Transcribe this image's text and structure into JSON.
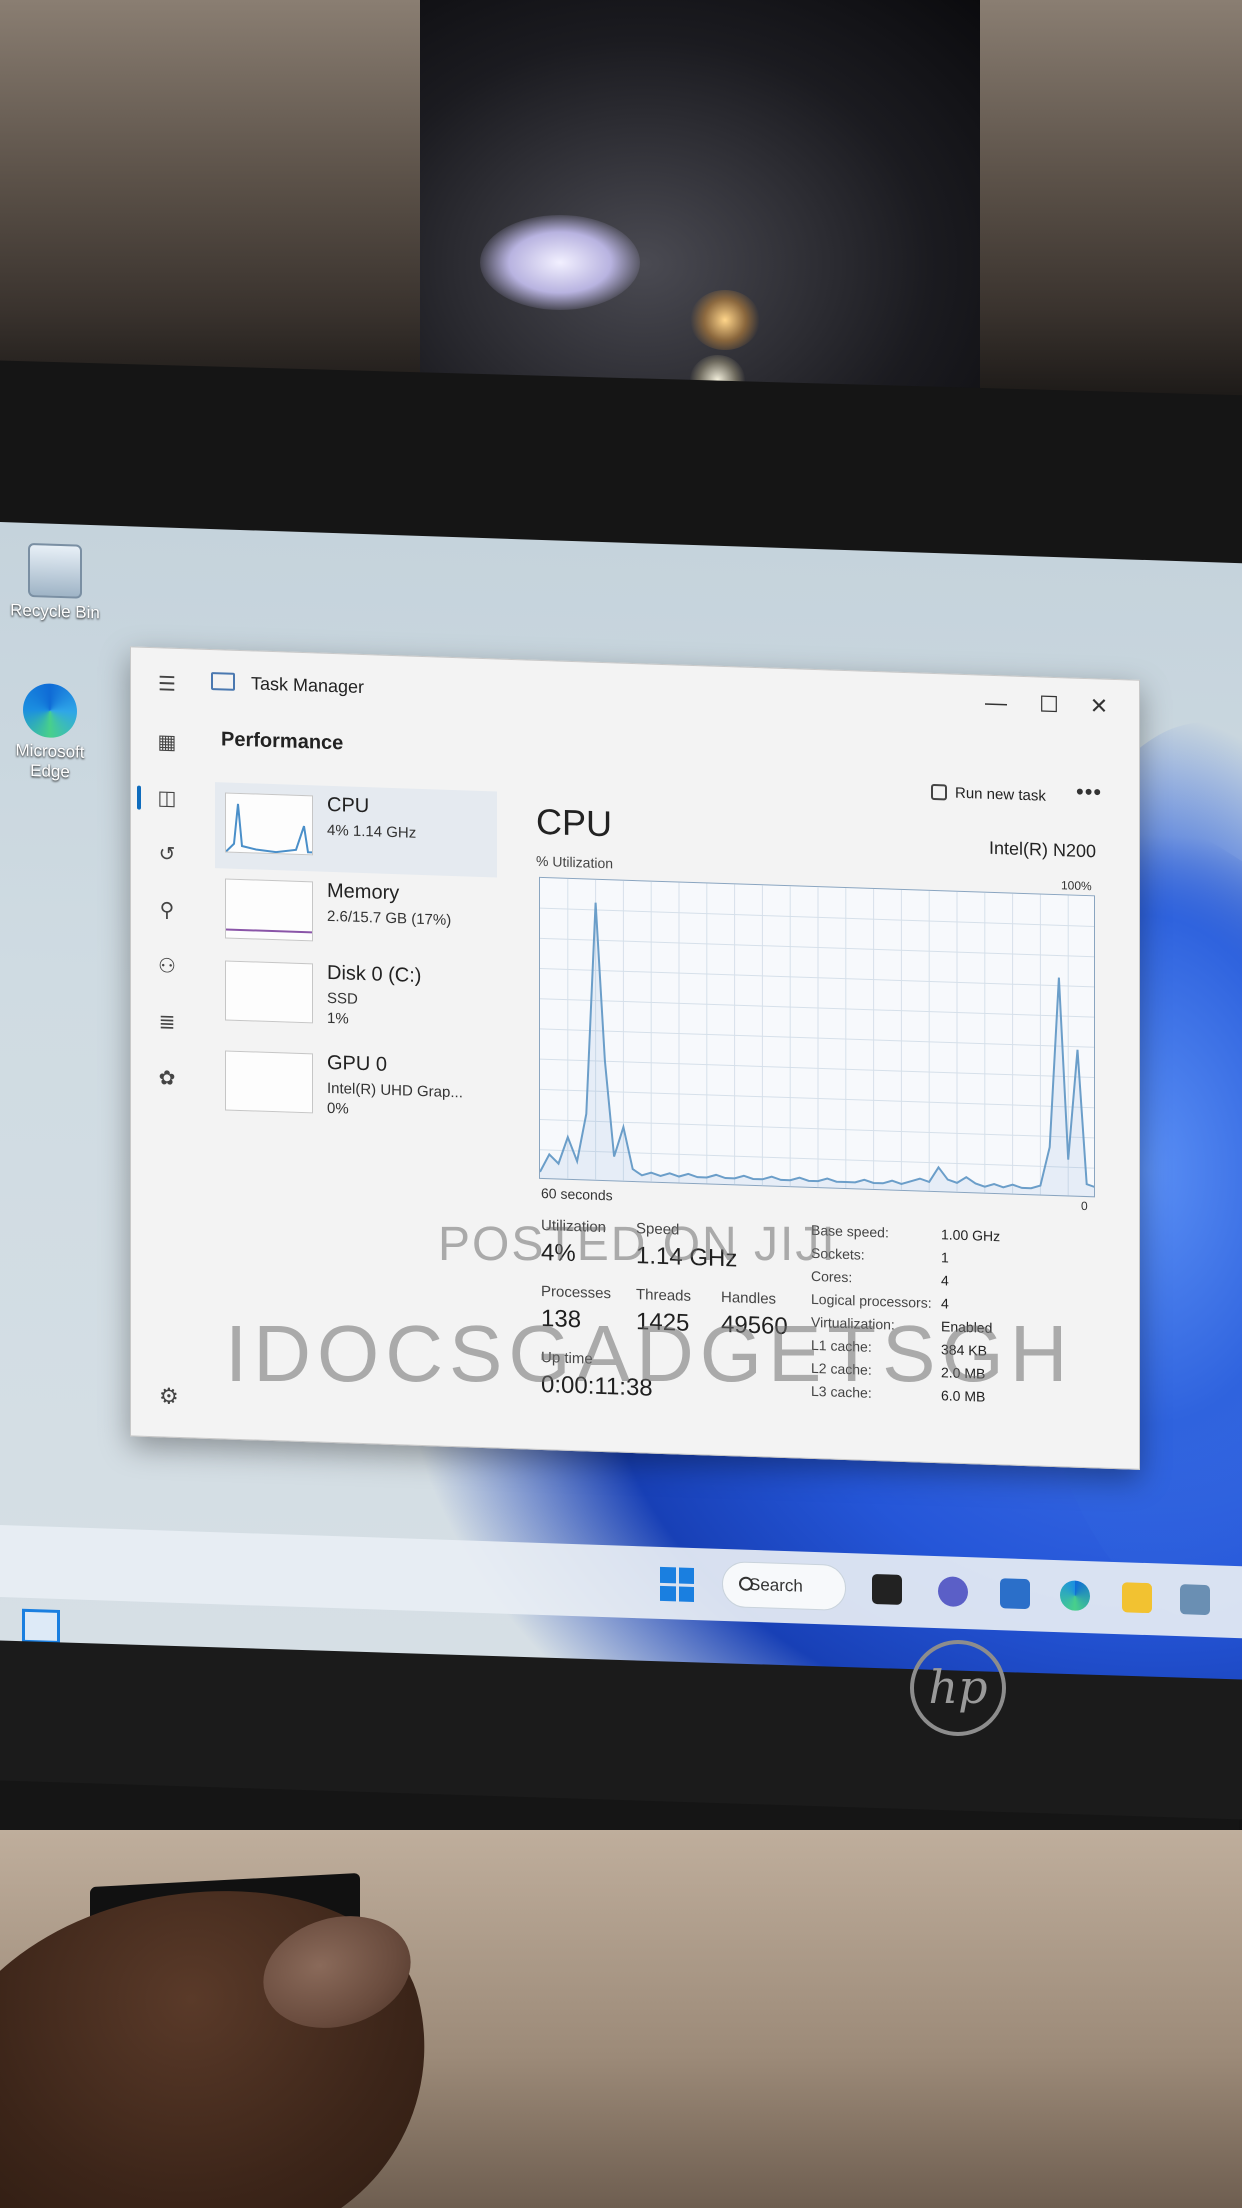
{
  "desktop": {
    "icons": [
      {
        "label": "Recycle Bin"
      },
      {
        "label": "Microsoft Edge"
      }
    ]
  },
  "taskbar": {
    "search_label": "Search"
  },
  "task_manager": {
    "title": "Task Manager",
    "section": "Performance",
    "run_new_task": "Run new task",
    "more": "•••",
    "window_buttons": {
      "minimize": "—",
      "maximize": "☐",
      "close": "✕"
    },
    "devices": [
      {
        "name": "CPU",
        "sub1": "4%  1.14 GHz",
        "sub2": ""
      },
      {
        "name": "Memory",
        "sub1": "2.6/15.7 GB (17%)",
        "sub2": ""
      },
      {
        "name": "Disk 0 (C:)",
        "sub1": "SSD",
        "sub2": "1%"
      },
      {
        "name": "GPU 0",
        "sub1": "Intel(R) UHD Grap...",
        "sub2": "0%"
      }
    ],
    "detail": {
      "title": "CPU",
      "model": "Intel(R) N200",
      "util_label": "% Utilization",
      "max_label": "100%",
      "time_label": "60 seconds",
      "min_label": "0",
      "stats": {
        "utilization_label": "Utilization",
        "utilization": "4%",
        "speed_label": "Speed",
        "speed": "1.14 GHz",
        "processes_label": "Processes",
        "processes": "138",
        "threads_label": "Threads",
        "threads": "1425",
        "handles_label": "Handles",
        "handles": "49560",
        "uptime_label": "Up time",
        "uptime": "0:00:11:38"
      },
      "specs": [
        {
          "k": "Base speed:",
          "v": "1.00 GHz"
        },
        {
          "k": "Sockets:",
          "v": "1"
        },
        {
          "k": "Cores:",
          "v": "4"
        },
        {
          "k": "Logical processors:",
          "v": "4"
        },
        {
          "k": "Virtualization:",
          "v": "Enabled"
        },
        {
          "k": "L1 cache:",
          "v": "384 KB"
        },
        {
          "k": "L2 cache:",
          "v": "2.0 MB"
        },
        {
          "k": "L3 cache:",
          "v": "6.0 MB"
        }
      ]
    }
  },
  "watermark": {
    "line1": "POSTED ON JIJI",
    "line2": "IDOCSGADGETSGH"
  },
  "brand_logo": "hp",
  "chart_data": {
    "type": "area",
    "title": "CPU",
    "ylabel": "% Utilization",
    "xlabel": "60 seconds",
    "ylim": [
      0,
      100
    ],
    "x": [
      0,
      1,
      2,
      3,
      4,
      5,
      6,
      7,
      8,
      9,
      10,
      11,
      12,
      13,
      14,
      15,
      16,
      17,
      18,
      19,
      20,
      21,
      22,
      23,
      24,
      25,
      26,
      27,
      28,
      29,
      30,
      31,
      32,
      33,
      34,
      35,
      36,
      37,
      38,
      39,
      40,
      41,
      42,
      43,
      44,
      45,
      46,
      47,
      48,
      49,
      50,
      51,
      52,
      53,
      54,
      55,
      56,
      57,
      58,
      59,
      60
    ],
    "series": [
      {
        "values": [
          2,
          8,
          5,
          14,
          6,
          22,
          93,
          40,
          8,
          18,
          4,
          2,
          3,
          2,
          3,
          2,
          3,
          2,
          2,
          3,
          2,
          2,
          3,
          2,
          2,
          3,
          2,
          2,
          3,
          2,
          2,
          3,
          2,
          2,
          2,
          3,
          2,
          2,
          3,
          2,
          3,
          4,
          3,
          8,
          4,
          3,
          5,
          3,
          2,
          3,
          2,
          3,
          2,
          2,
          3,
          16,
          73,
          12,
          49,
          4,
          3
        ]
      }
    ]
  }
}
